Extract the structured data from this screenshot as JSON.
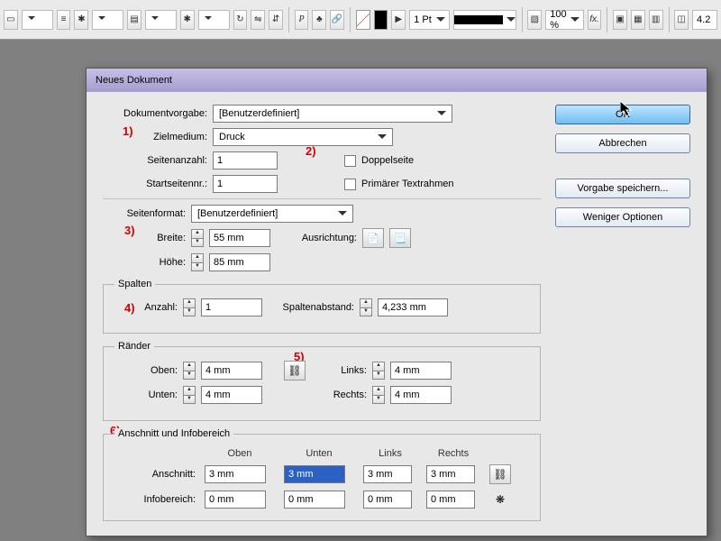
{
  "toolbar": {
    "stroke_weight": "1 Pt",
    "zoom": "100 %",
    "fx_label": "fx.",
    "crop_num": "4.2"
  },
  "dialog": {
    "title": "Neues Dokument",
    "labels": {
      "doc_preset": "Dokumentvorgabe:",
      "intent": "Zielmedium:",
      "pages": "Seitenanzahl:",
      "start_page": "Startseitennr.:",
      "facing": "Doppelseite",
      "primary_tf": "Primärer Textrahmen",
      "page_format": "Seitenformat:",
      "width": "Breite:",
      "height": "Höhe:",
      "orientation": "Ausrichtung:",
      "columns_group": "Spalten",
      "col_count": "Anzahl:",
      "col_gutter": "Spaltenabstand:",
      "margins_group": "Ränder",
      "top": "Oben:",
      "bottom": "Unten:",
      "left": "Links:",
      "right": "Rechts:",
      "bleed_group": "Anschnitt und Infobereich",
      "bleed": "Anschnitt:",
      "slug": "Infobereich:"
    },
    "values": {
      "doc_preset": "[Benutzerdefiniert]",
      "intent": "Druck",
      "pages": "1",
      "start_page": "1",
      "page_format": "[Benutzerdefiniert]",
      "width": "55 mm",
      "height": "85 mm",
      "col_count": "1",
      "col_gutter": "4,233 mm",
      "margin_top": "4 mm",
      "margin_bottom": "4 mm",
      "margin_left": "4 mm",
      "margin_right": "4 mm",
      "bleed_top": "3 mm",
      "bleed_bottom": "3 mm",
      "bleed_left": "3 mm",
      "bleed_right": "3 mm",
      "slug_top": "0 mm",
      "slug_bottom": "0 mm",
      "slug_left": "0 mm",
      "slug_right": "0 mm"
    },
    "headers": {
      "top": "Oben",
      "bottom": "Unten",
      "left": "Links",
      "right": "Rechts"
    },
    "buttons": {
      "ok": "OK",
      "cancel": "Abbrechen",
      "save_preset": "Vorgabe speichern...",
      "fewer_options": "Weniger Optionen"
    },
    "annotations": {
      "a1": "1)",
      "a2": "2)",
      "a3": "3)",
      "a4": "4)",
      "a5": "5)",
      "a6": "6)"
    }
  }
}
